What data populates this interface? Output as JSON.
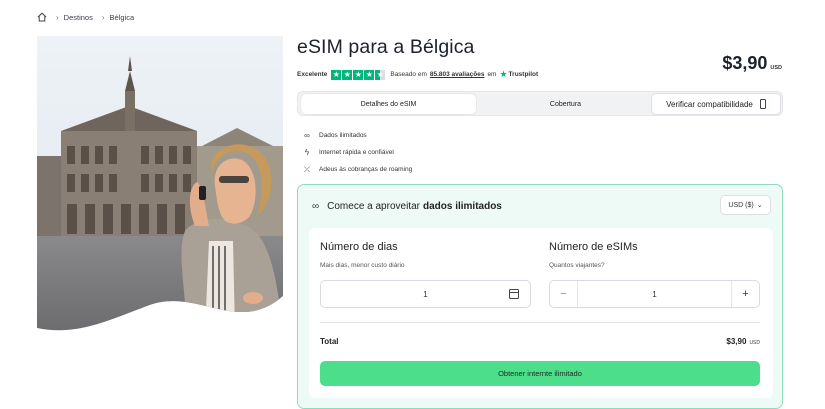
{
  "breadcrumb": {
    "items": [
      "Destinos",
      "Bélgica"
    ]
  },
  "product": {
    "title": "eSIM para a Bélgica",
    "price": "$3,90",
    "price_currency": "USD"
  },
  "rating": {
    "label": "Excelente",
    "stars": 4.5,
    "text_before": "Baseado em",
    "reviews_link": "85.803 avaliações",
    "text_after": "em",
    "brand": "Trustpilot",
    "color": "#00b67a"
  },
  "tabs": {
    "details": "Detalhes do eSIM",
    "coverage": "Cobertura",
    "compat": "Verificar compatibilidade"
  },
  "features": [
    {
      "icon": "infinity-icon",
      "label": "Dados ilimitados"
    },
    {
      "icon": "lightning-icon",
      "label": "Internet rápida e confiável"
    },
    {
      "icon": "no-roaming-icon",
      "label": "Adeus às cobranças de roaming"
    }
  ],
  "panel": {
    "heading_prefix": "Comece a aproveitar",
    "heading_bold": "dados ilimitados",
    "currency_select": "USD ($)",
    "days_title": "Número de dias",
    "days_sub": "Mais dias, menor custo diário",
    "days_value": "1",
    "sims_title": "Número de eSIMs",
    "sims_sub": "Quantos viajantes?",
    "sims_value": "1",
    "minus": "−",
    "plus": "+",
    "total_label": "Total",
    "total_value": "$3,90",
    "total_currency": "USD",
    "cta": "Obtener internte ilimitado",
    "accent": "#4cde8a"
  }
}
